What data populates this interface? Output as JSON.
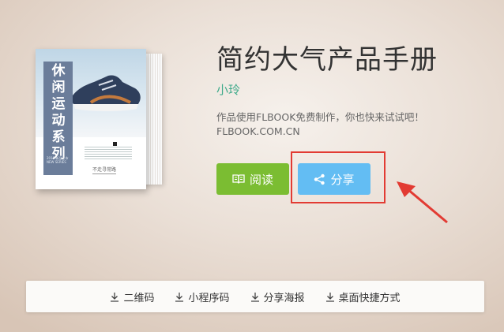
{
  "book": {
    "cover_title_vertical": "休闲运动系列",
    "cover_caption": "不走寻常路",
    "cover_small_text": "2018 新品上市 NEW SERIES"
  },
  "product": {
    "title": "简约大气产品手册",
    "author": "小玲",
    "description": "作品使用FLBOOK免费制作，你也快来试试吧！FLBOOK.COM.CN"
  },
  "buttons": {
    "read_label": "阅读",
    "share_label": "分享"
  },
  "toolbar": {
    "items": [
      {
        "label": "二维码",
        "icon": "download-icon"
      },
      {
        "label": "小程序码",
        "icon": "download-icon"
      },
      {
        "label": "分享海报",
        "icon": "download-icon"
      },
      {
        "label": "桌面快捷方式",
        "icon": "download-icon"
      }
    ]
  },
  "colors": {
    "read_button": "#7bbd32",
    "share_button": "#63bdf3",
    "author": "#3eaa8a",
    "annotation": "#e23b33"
  }
}
